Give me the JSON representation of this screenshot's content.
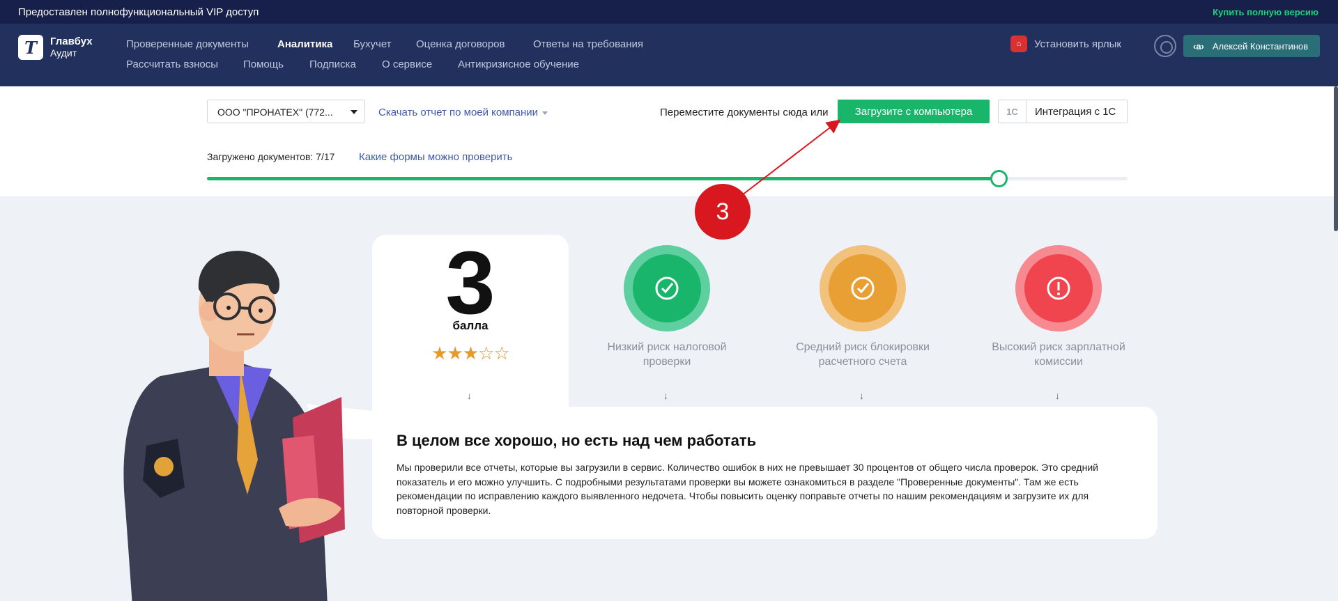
{
  "vip_bar": {
    "text": "Предоставлен полнофункциональный VIP доступ",
    "buy_link": "Купить полную версию"
  },
  "header": {
    "logo": {
      "title": "Главбух",
      "subtitle": "Аудит"
    },
    "nav_row1": [
      "Проверенные документы",
      "Аналитика",
      "Бухучет",
      "Оценка договоров",
      "Ответы на требования"
    ],
    "nav_row2": [
      "Рассчитать взносы",
      "Помощь",
      "Подписка",
      "О сервисе",
      "Антикризисное обучение"
    ],
    "active_item": "Аналитика",
    "shortcut_label": "Установить ярлык",
    "user_name": "Алексей Константинов"
  },
  "upload_panel": {
    "company_select": "ООО \"ПРОНАТЕХ\" (772...",
    "download_report": "Скачать отчет по моей компании",
    "drop_text": "Переместите документы сюда или",
    "upload_button": "Загрузите с компьютера",
    "integration_icon": "1С",
    "integration_button": "Интеграция с 1С",
    "loaded_label": "Загружено документов: 7/17",
    "forms_link": "Какие формы можно проверить",
    "progress_fraction": 0.86
  },
  "annotation": {
    "number": "3"
  },
  "score": {
    "value": "3",
    "unit": "балла",
    "stars_filled": 3,
    "stars_total": 5
  },
  "risks": [
    {
      "label": "Низкий риск налоговой проверки",
      "color": "#19b56b",
      "halo": "#5ed0a0",
      "icon": "check-icon"
    },
    {
      "label": "Средний риск блокировки расчетного счета",
      "color": "#e89f33",
      "halo": "#f2c27d",
      "icon": "check-icon"
    },
    {
      "label": "Высокий риск зарплатной комиссии",
      "color": "#f0444f",
      "halo": "#f78a90",
      "icon": "exclamation-icon"
    }
  ],
  "message": {
    "title": "В целом все хорошо, но есть над чем работать",
    "body": "Мы проверили все отчеты, которые вы загрузили в сервис. Количество ошибок в них не превышает 30 процентов от общего числа проверок. Это средний показатель и его можно улучшить. С подробными результатами проверки вы можете ознакомиться в разделе \"Проверенные документы\". Там же есть рекомендации по исправлению каждого выявленного недочета. Чтобы повысить оценку поправьте отчеты по нашим рекомендациям и загрузите их для повторной проверки."
  }
}
